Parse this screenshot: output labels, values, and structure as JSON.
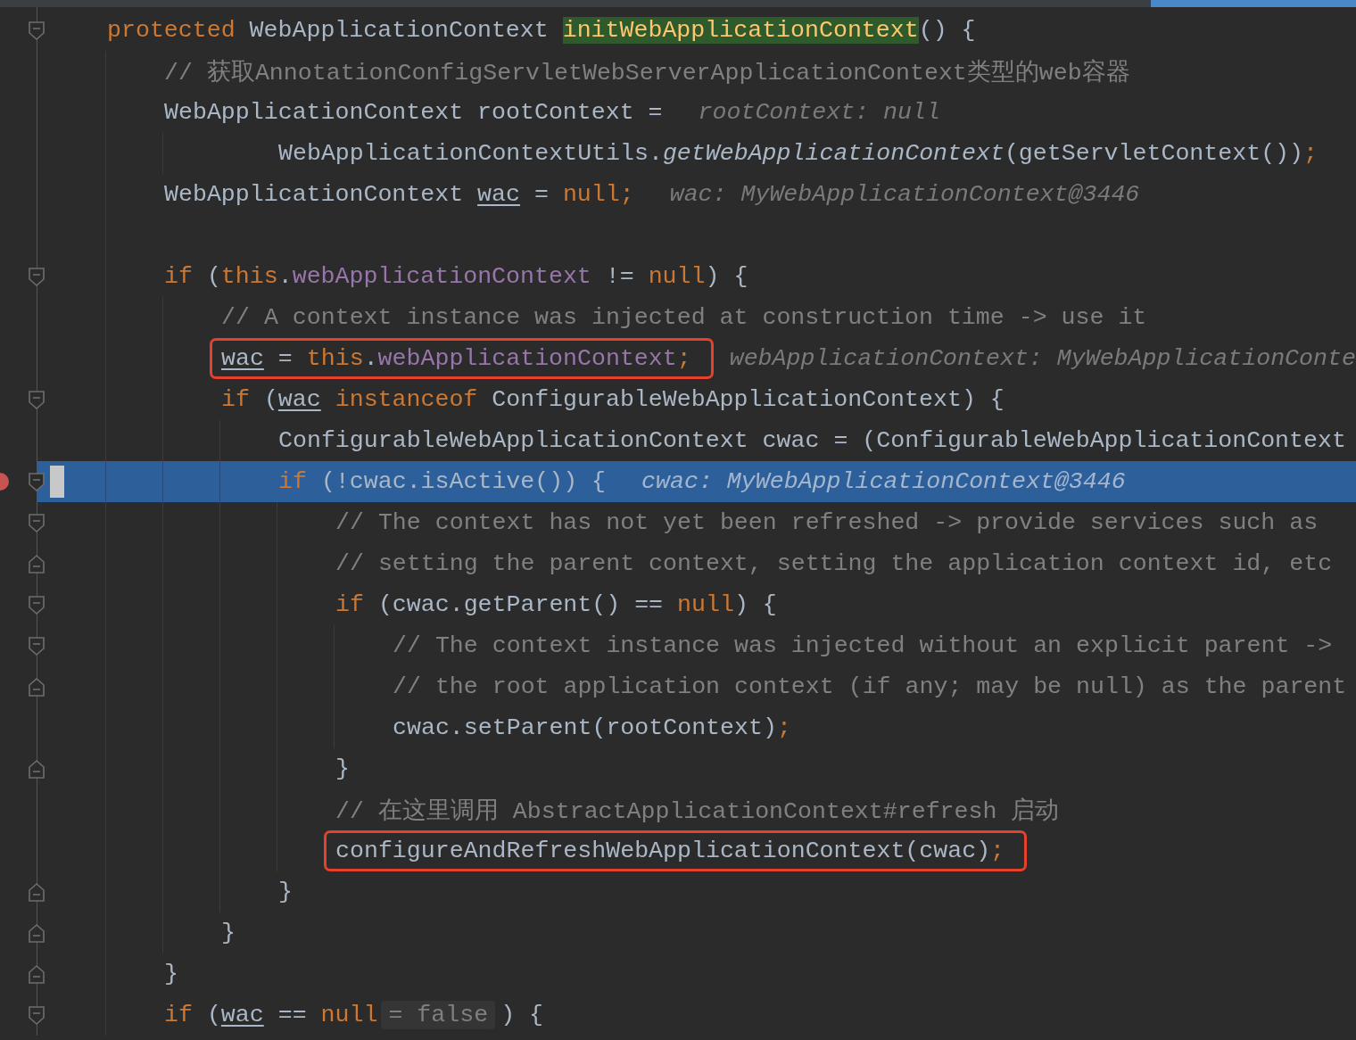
{
  "editor": {
    "lines": [
      {
        "fold": {
          "kind": "start"
        },
        "current": false,
        "breakpoint": false,
        "segments": [
          {
            "kind": "code",
            "tokens": [
              {
                "kind": "keyword",
                "text": "protected "
              },
              {
                "kind": "plain",
                "text": "WebApplicationContext "
              },
              {
                "kind": "method-decl",
                "text": "initWebApplicationContext"
              },
              {
                "kind": "plain",
                "text": "() {"
              }
            ]
          }
        ],
        "children": [
          {
            "current": false,
            "breakpoint": false,
            "segments": [
              {
                "kind": "code",
                "tokens": [
                  {
                    "kind": "comment",
                    "text": "// 获取AnnotationConfigServletWebServerApplicationContext类型的web容器"
                  }
                ]
              }
            ]
          },
          {
            "current": false,
            "breakpoint": false,
            "segments": [
              {
                "kind": "code",
                "tokens": [
                  {
                    "kind": "plain",
                    "text": "WebApplicationContext rootContext ="
                  }
                ]
              },
              {
                "kind": "hint",
                "text": "rootContext: null"
              }
            ],
            "continuation": [
              {
                "current": false,
                "breakpoint": false,
                "segments": [
                  {
                    "kind": "code",
                    "tokens": [
                      {
                        "kind": "plain",
                        "text": "WebApplicationContextUtils."
                      },
                      {
                        "kind": "static",
                        "text": "getWebApplicationContext"
                      },
                      {
                        "kind": "plain",
                        "text": "(getServletContext())"
                      },
                      {
                        "kind": "keyword",
                        "text": ";"
                      }
                    ]
                  }
                ]
              }
            ]
          },
          {
            "current": false,
            "breakpoint": false,
            "segments": [
              {
                "kind": "code",
                "tokens": [
                  {
                    "kind": "plain",
                    "text": "WebApplicationContext "
                  },
                  {
                    "kind": "local",
                    "text": "wac"
                  },
                  {
                    "kind": "plain",
                    "text": " = "
                  },
                  {
                    "kind": "keyword",
                    "text": "null;"
                  }
                ]
              },
              {
                "kind": "hint",
                "text": "wac: MyWebApplicationContext@3446"
              }
            ]
          },
          {
            "current": false,
            "breakpoint": false
          },
          {
            "fold": {
              "kind": "start"
            },
            "current": false,
            "breakpoint": false,
            "segments": [
              {
                "kind": "code",
                "tokens": [
                  {
                    "kind": "keyword",
                    "text": "if "
                  },
                  {
                    "kind": "plain",
                    "text": "("
                  },
                  {
                    "kind": "keyword",
                    "text": "this"
                  },
                  {
                    "kind": "plain",
                    "text": "."
                  },
                  {
                    "kind": "field",
                    "text": "webApplicationContext"
                  },
                  {
                    "kind": "plain",
                    "text": " != "
                  },
                  {
                    "kind": "keyword",
                    "text": "null"
                  },
                  {
                    "kind": "plain",
                    "text": ") {"
                  }
                ]
              }
            ],
            "children": [
              {
                "current": false,
                "breakpoint": false,
                "segments": [
                  {
                    "kind": "code",
                    "tokens": [
                      {
                        "kind": "comment",
                        "text": "// A context instance was injected at construction time -> use it"
                      }
                    ]
                  }
                ]
              },
              {
                "current": false,
                "breakpoint": false,
                "segments": [
                  {
                    "kind": "code",
                    "boxed": true,
                    "tokens": [
                      {
                        "kind": "local",
                        "text": "wac"
                      },
                      {
                        "kind": "plain",
                        "text": " = "
                      },
                      {
                        "kind": "keyword",
                        "text": "this"
                      },
                      {
                        "kind": "plain",
                        "text": "."
                      },
                      {
                        "kind": "field",
                        "text": "webApplicationContext"
                      },
                      {
                        "kind": "keyword",
                        "text": ";"
                      }
                    ]
                  },
                  {
                    "kind": "hint",
                    "text": "webApplicationContext: MyWebApplicationConte"
                  }
                ]
              },
              {
                "fold": {
                  "kind": "start"
                },
                "current": false,
                "breakpoint": false,
                "segments": [
                  {
                    "kind": "code",
                    "tokens": [
                      {
                        "kind": "keyword",
                        "text": "if "
                      },
                      {
                        "kind": "plain",
                        "text": "("
                      },
                      {
                        "kind": "local",
                        "text": "wac"
                      },
                      {
                        "kind": "keyword",
                        "text": " instanceof "
                      },
                      {
                        "kind": "plain",
                        "text": "ConfigurableWebApplicationContext) {"
                      }
                    ]
                  }
                ],
                "children": [
                  {
                    "current": false,
                    "breakpoint": false,
                    "segments": [
                      {
                        "kind": "code",
                        "tokens": [
                          {
                            "kind": "plain",
                            "text": "ConfigurableWebApplicationContext cwac = (ConfigurableWebApplicationContext"
                          }
                        ]
                      }
                    ]
                  },
                  {
                    "fold": {
                      "kind": "start"
                    },
                    "current": true,
                    "breakpoint": true,
                    "segments": [
                      {
                        "kind": "code",
                        "tokens": [
                          {
                            "kind": "keyword",
                            "text": "if "
                          },
                          {
                            "kind": "plain",
                            "text": "(!cwac.isActive()) {"
                          }
                        ]
                      },
                      {
                        "kind": "hint",
                        "text": "cwac: MyWebApplicationContext@3446"
                      }
                    ],
                    "children": [
                      {
                        "fold": {
                          "kind": "start"
                        },
                        "current": false,
                        "breakpoint": false,
                        "segments": [
                          {
                            "kind": "code",
                            "tokens": [
                              {
                                "kind": "comment",
                                "text": "// The context has not yet been refreshed -> provide services such as"
                              }
                            ]
                          }
                        ]
                      },
                      {
                        "fold": {
                          "kind": "end"
                        },
                        "current": false,
                        "breakpoint": false,
                        "segments": [
                          {
                            "kind": "code",
                            "tokens": [
                              {
                                "kind": "comment",
                                "text": "// setting the parent context, setting the application context id, etc"
                              }
                            ]
                          }
                        ]
                      },
                      {
                        "fold": {
                          "kind": "start"
                        },
                        "current": false,
                        "breakpoint": false,
                        "segments": [
                          {
                            "kind": "code",
                            "tokens": [
                              {
                                "kind": "keyword",
                                "text": "if "
                              },
                              {
                                "kind": "plain",
                                "text": "(cwac.getParent() == "
                              },
                              {
                                "kind": "keyword",
                                "text": "null"
                              },
                              {
                                "kind": "plain",
                                "text": ") {"
                              }
                            ]
                          }
                        ],
                        "children": [
                          {
                            "fold": {
                              "kind": "start"
                            },
                            "current": false,
                            "breakpoint": false,
                            "segments": [
                              {
                                "kind": "code",
                                "tokens": [
                                  {
                                    "kind": "comment",
                                    "text": "// The context instance was injected without an explicit parent ->"
                                  }
                                ]
                              }
                            ]
                          },
                          {
                            "fold": {
                              "kind": "end"
                            },
                            "current": false,
                            "breakpoint": false,
                            "segments": [
                              {
                                "kind": "code",
                                "tokens": [
                                  {
                                    "kind": "comment",
                                    "text": "// the root application context (if any; may be null) as the parent"
                                  }
                                ]
                              }
                            ]
                          },
                          {
                            "current": false,
                            "breakpoint": false,
                            "segments": [
                              {
                                "kind": "code",
                                "tokens": [
                                  {
                                    "kind": "plain",
                                    "text": "cwac.setParent(rootContext)"
                                  },
                                  {
                                    "kind": "keyword",
                                    "text": ";"
                                  }
                                ]
                              }
                            ]
                          }
                        ]
                      },
                      {
                        "fold": {
                          "kind": "end"
                        },
                        "current": false,
                        "breakpoint": false,
                        "segments": [
                          {
                            "kind": "code",
                            "tokens": [
                              {
                                "kind": "plain",
                                "text": "}"
                              }
                            ]
                          }
                        ]
                      },
                      {
                        "current": false,
                        "breakpoint": false,
                        "segments": [
                          {
                            "kind": "code",
                            "tokens": [
                              {
                                "kind": "comment",
                                "text": "// 在这里调用 AbstractApplicationContext#refresh 启动"
                              }
                            ]
                          }
                        ]
                      },
                      {
                        "current": false,
                        "breakpoint": false,
                        "segments": [
                          {
                            "kind": "code",
                            "boxed": true,
                            "tokens": [
                              {
                                "kind": "plain",
                                "text": "configureAndRefreshWebApplicationContext(cwac)"
                              },
                              {
                                "kind": "keyword",
                                "text": ";"
                              }
                            ]
                          }
                        ]
                      }
                    ]
                  },
                  {
                    "fold": {
                      "kind": "end"
                    },
                    "current": false,
                    "breakpoint": false,
                    "segments": [
                      {
                        "kind": "code",
                        "tokens": [
                          {
                            "kind": "plain",
                            "text": "}"
                          }
                        ]
                      }
                    ]
                  }
                ]
              },
              {
                "fold": {
                  "kind": "end"
                },
                "current": false,
                "breakpoint": false,
                "segments": [
                  {
                    "kind": "code",
                    "tokens": [
                      {
                        "kind": "plain",
                        "text": "}"
                      }
                    ]
                  }
                ]
              }
            ]
          },
          {
            "fold": {
              "kind": "end"
            },
            "current": false,
            "breakpoint": false,
            "segments": [
              {
                "kind": "code",
                "tokens": [
                  {
                    "kind": "plain",
                    "text": "}"
                  }
                ]
              }
            ]
          },
          {
            "fold": {
              "kind": "start"
            },
            "current": false,
            "breakpoint": false,
            "segments": [
              {
                "kind": "code",
                "tokens": [
                  {
                    "kind": "keyword",
                    "text": "if "
                  },
                  {
                    "kind": "plain",
                    "text": "("
                  },
                  {
                    "kind": "local",
                    "text": "wac"
                  },
                  {
                    "kind": "plain",
                    "text": " == "
                  },
                  {
                    "kind": "keyword",
                    "text": "null"
                  }
                ]
              },
              {
                "kind": "chip",
                "text": "= false"
              },
              {
                "kind": "code",
                "tokens": [
                  {
                    "kind": "plain",
                    "text": ") {"
                  }
                ]
              }
            ]
          }
        ]
      }
    ]
  }
}
